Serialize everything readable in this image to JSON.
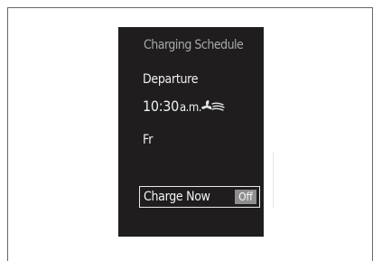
{
  "screen": {
    "title": "Charging Schedule",
    "departure_label": "Departure",
    "time_value": "10:30",
    "time_suffix": "a.m.",
    "day": "Fr",
    "climate_icon": "fan-air-flow-icon"
  },
  "charge_now": {
    "label": "Charge Now",
    "status": "Off"
  },
  "colors": {
    "screen_background": "#1f1d1e",
    "title_text": "#a8a8a8",
    "primary_text": "#f0f0f0",
    "off_badge": "#8e8e8e"
  }
}
